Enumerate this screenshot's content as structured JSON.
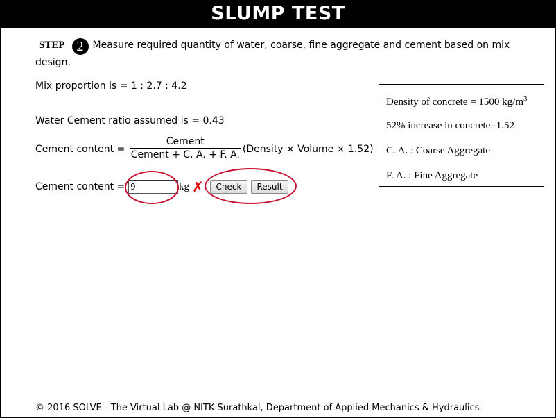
{
  "header": {
    "title": "SLUMP TEST"
  },
  "step": {
    "word": "STEP",
    "number": "2",
    "text": "Measure required quantity of water, coarse, fine aggregate and cement based on mix design."
  },
  "mix_proportion": "Mix proportion is = 1 : 2.7 : 4.2",
  "wc_ratio": "Water Cement ratio assumed is = 0.43",
  "formula": {
    "lhs": "Cement content =",
    "numerator": "Cement",
    "denominator": "Cement + C. A. + F. A.",
    "rhs": "(Density × Volume × 1.52)"
  },
  "answer": {
    "label": "Cement content =",
    "value": "9",
    "unit": "kg",
    "status_icon": "cross-icon",
    "status_color": "#e00000",
    "check_label": "Check",
    "result_label": "Result"
  },
  "info": {
    "density_prefix": "Density of concrete = 1500 kg/m",
    "density_exp": "3",
    "increase": "52% increase in concrete=1.52",
    "ca": "C. A. : Coarse Aggregate",
    "fa": "F. A. : Fine Aggregate"
  },
  "footer": "© 2016 SOLVE - The Virtual Lab @ NITK Surathkal, Department of Applied Mechanics & Hydraulics",
  "colors": {
    "header_bg": "#000000",
    "annotation_ring": "#c8102e"
  }
}
